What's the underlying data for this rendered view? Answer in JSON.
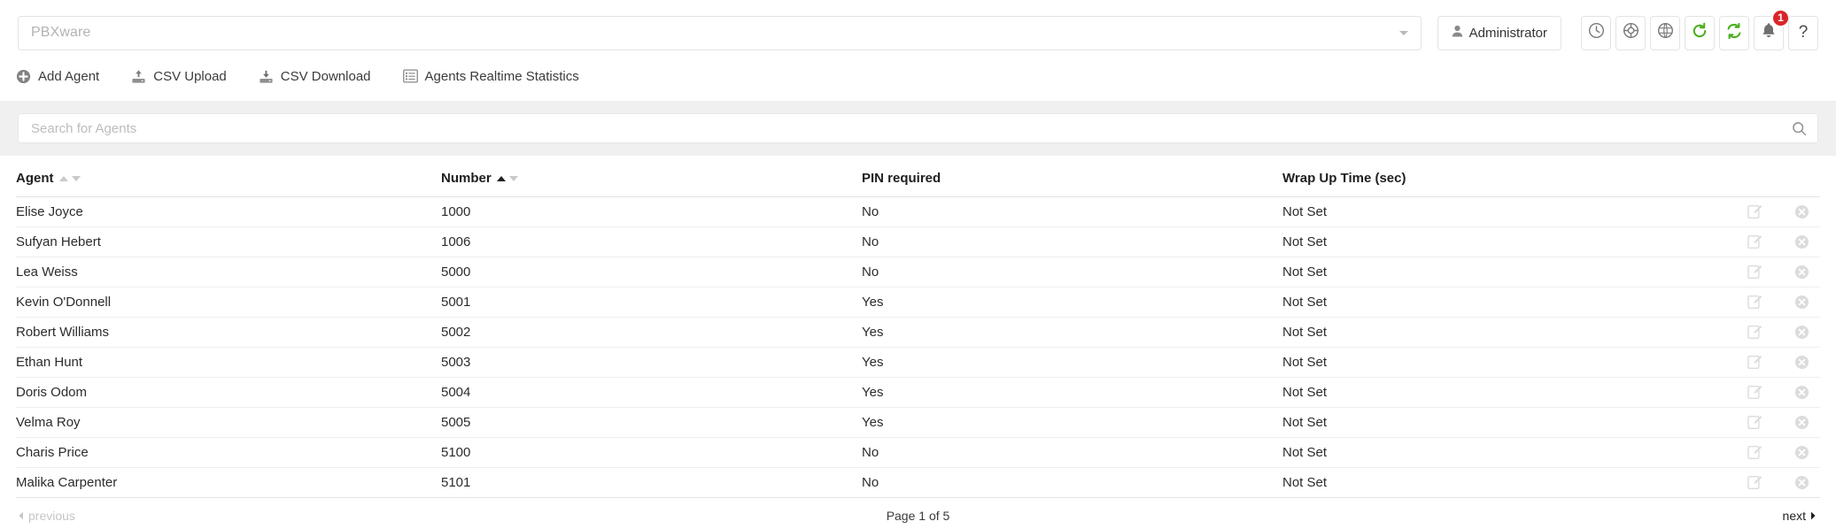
{
  "topbar": {
    "tenant_value": "PBXware",
    "tenant_caret": "chevron-down",
    "admin_label": "Administrator",
    "icons": [
      {
        "name": "clock-icon",
        "title": "Clock"
      },
      {
        "name": "lifebuoy-icon",
        "title": "Support"
      },
      {
        "name": "globe-icon",
        "title": "Globe"
      },
      {
        "name": "refresh-icon",
        "title": "Refresh"
      },
      {
        "name": "sync-icon",
        "title": "Sync"
      },
      {
        "name": "bell-icon",
        "title": "Notifications"
      },
      {
        "name": "help-icon",
        "title": "Help"
      }
    ],
    "notification_count": "1",
    "help_glyph": "?",
    "accent_green": "#4caf20",
    "badge_red": "#d9252a"
  },
  "actionbar": {
    "items": [
      {
        "label": "Add Agent",
        "icon": "plus-circle-icon"
      },
      {
        "label": "CSV Upload",
        "icon": "upload-icon"
      },
      {
        "label": "CSV Download",
        "icon": "download-icon"
      },
      {
        "label": "Agents Realtime Statistics",
        "icon": "list-table-icon"
      }
    ]
  },
  "search": {
    "placeholder": "Search for Agents",
    "value": "",
    "icon": "search-icon"
  },
  "table": {
    "columns": [
      {
        "label": "Agent",
        "sortable": true,
        "sort_state": "none"
      },
      {
        "label": "Number",
        "sortable": true,
        "sort_state": "asc"
      },
      {
        "label": "PIN required",
        "sortable": false,
        "sort_state": "none"
      },
      {
        "label": "Wrap Up Time (sec)",
        "sortable": false,
        "sort_state": "none"
      }
    ],
    "rows": [
      {
        "agent": "Elise Joyce",
        "number": "1000",
        "pin": "No",
        "wrap": "Not Set"
      },
      {
        "agent": "Sufyan Hebert",
        "number": "1006",
        "pin": "No",
        "wrap": "Not Set"
      },
      {
        "agent": "Lea Weiss",
        "number": "5000",
        "pin": "No",
        "wrap": "Not Set"
      },
      {
        "agent": "Kevin O'Donnell",
        "number": "5001",
        "pin": "Yes",
        "wrap": "Not Set"
      },
      {
        "agent": "Robert Williams",
        "number": "5002",
        "pin": "Yes",
        "wrap": "Not Set"
      },
      {
        "agent": "Ethan Hunt",
        "number": "5003",
        "pin": "Yes",
        "wrap": "Not Set"
      },
      {
        "agent": "Doris Odom",
        "number": "5004",
        "pin": "Yes",
        "wrap": "Not Set"
      },
      {
        "agent": "Velma Roy",
        "number": "5005",
        "pin": "Yes",
        "wrap": "Not Set"
      },
      {
        "agent": "Charis Price",
        "number": "5100",
        "pin": "No",
        "wrap": "Not Set"
      },
      {
        "agent": "Malika Carpenter",
        "number": "5101",
        "pin": "No",
        "wrap": "Not Set"
      }
    ],
    "row_actions": [
      {
        "name": "edit-icon",
        "label": "Edit"
      },
      {
        "name": "delete-icon",
        "label": "Delete"
      }
    ]
  },
  "pagination": {
    "previous_label": "previous",
    "previous_enabled": false,
    "page_label": "Page 1 of 5",
    "next_label": "next",
    "next_enabled": true
  }
}
